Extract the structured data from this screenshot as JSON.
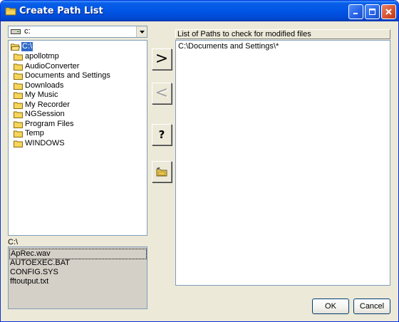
{
  "window": {
    "title": "Create Path List"
  },
  "titlebar_buttons": [
    "minimize",
    "maximize",
    "close"
  ],
  "drive": {
    "selected": "c:"
  },
  "directories": {
    "current": "C:\\",
    "items": [
      "apollotmp",
      "AudioConverter",
      "Documents and Settings",
      "Downloads",
      "My Music",
      "My Recorder",
      "NGSession",
      "Program Files",
      "Temp",
      "WINDOWS"
    ]
  },
  "current_path": "C:\\",
  "files": [
    "ApRec.wav",
    "AUTOEXEC.BAT",
    "CONFIG.SYS",
    "fftoutput.txt"
  ],
  "buttons": {
    "add": ">",
    "remove": "<",
    "help": "?",
    "ok": "OK",
    "cancel": "Cancel"
  },
  "paths_panel": {
    "header": "List of Paths to check for modified files",
    "items": [
      "C:\\Documents and Settings\\*"
    ]
  },
  "colors": {
    "title_bar": "#0055e5",
    "selection": "#316ac5",
    "window_bg": "#ece9d8"
  }
}
